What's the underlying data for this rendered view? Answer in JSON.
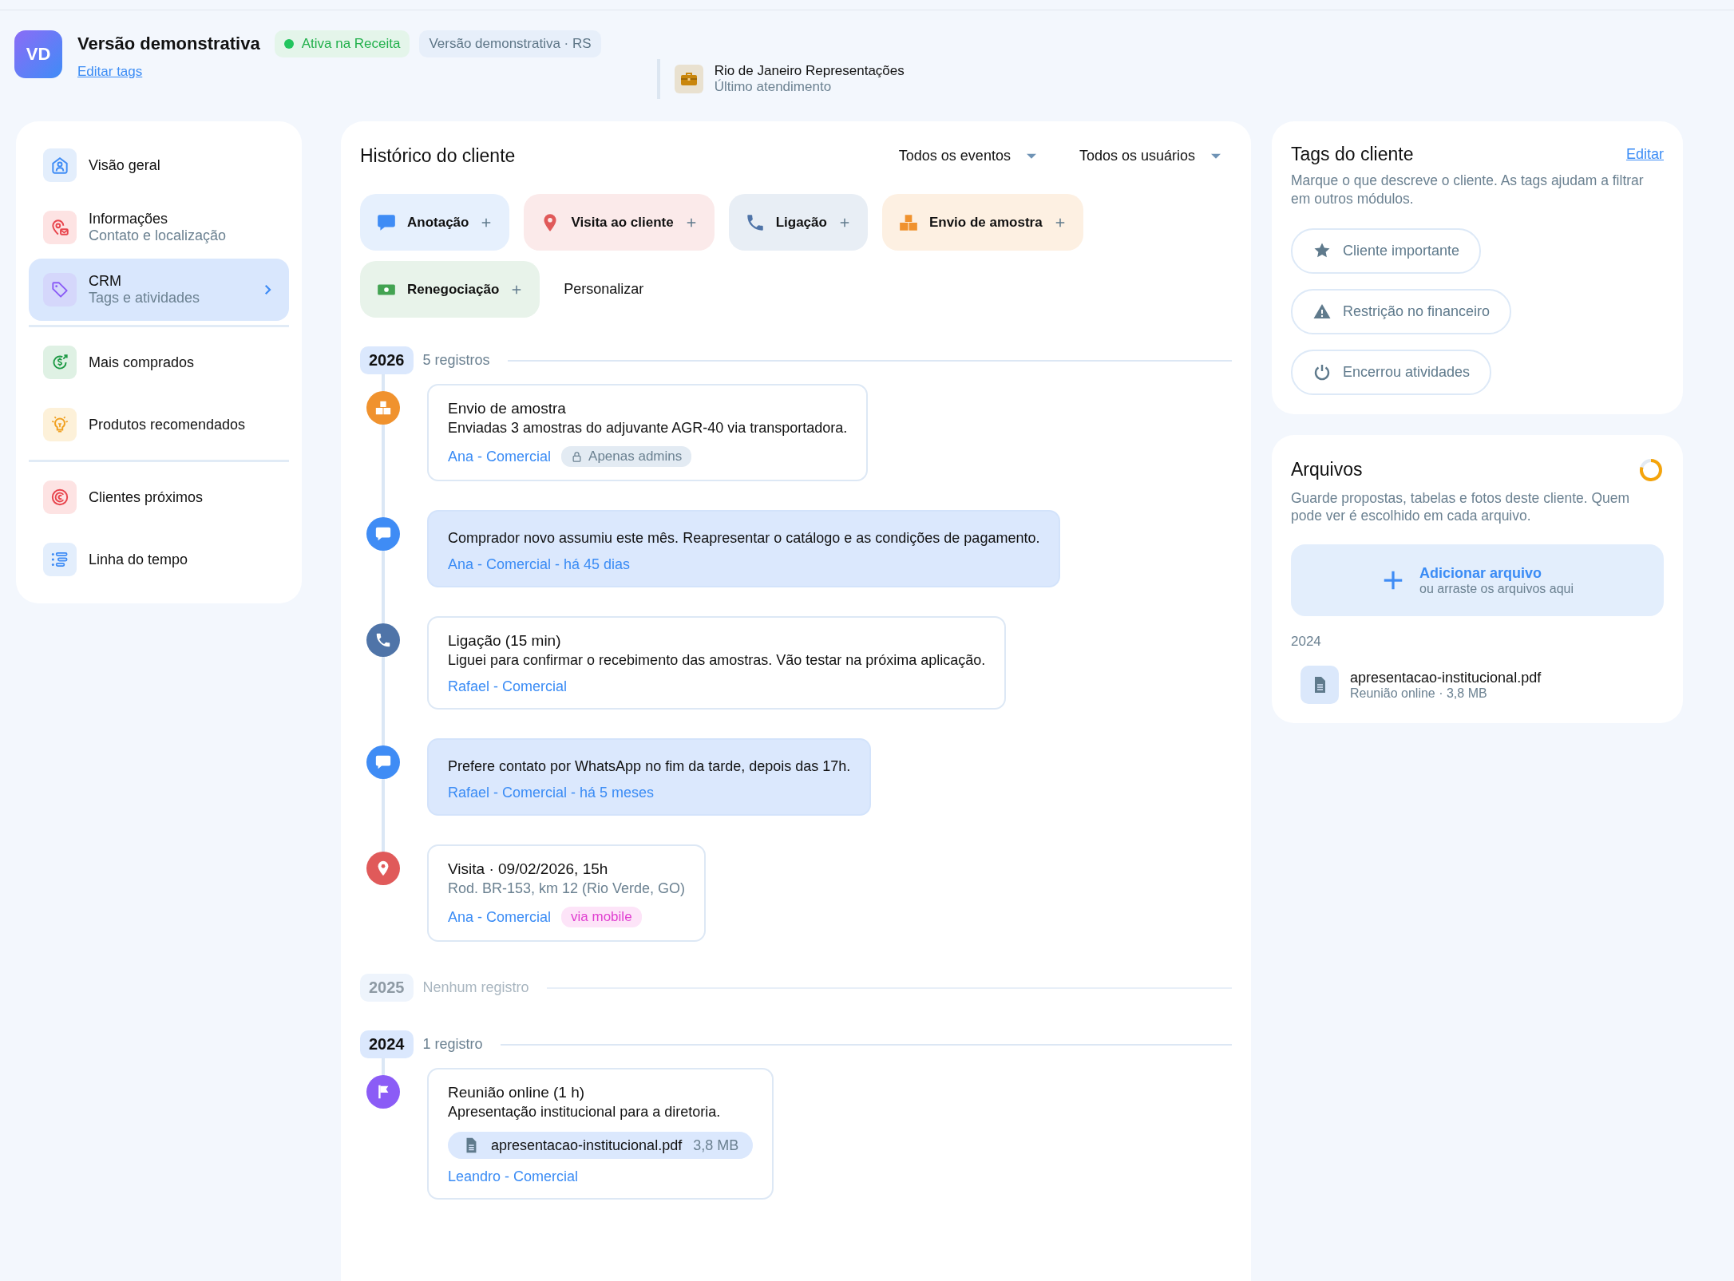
{
  "header": {
    "avatar": "VD",
    "title": "Versão demonstrativa",
    "edit_tags_link": "Editar tags",
    "badges": [
      {
        "kind": "status",
        "label": "Ativa na Receita"
      },
      {
        "kind": "plain",
        "label": "Versão demonstrativa · RS"
      }
    ],
    "last_contact": {
      "name": "Rio de Janeiro Representações",
      "caption": "Último atendimento"
    }
  },
  "sidebar": {
    "groups": [
      [
        {
          "kind": "overview",
          "label": "Visão geral",
          "selected": false
        },
        {
          "kind": "info",
          "label": "Informações",
          "sublabel": "Contato e localização",
          "selected": false
        },
        {
          "kind": "crm",
          "label": "CRM",
          "sublabel": "Tags e atividades",
          "selected": true
        }
      ],
      [
        {
          "kind": "purchases",
          "label": "Mais comprados",
          "selected": false
        },
        {
          "kind": "recommended",
          "label": "Produtos recomendados",
          "selected": false
        }
      ],
      [
        {
          "kind": "nearby",
          "label": "Clientes próximos",
          "selected": false
        },
        {
          "kind": "timeline",
          "label": "Linha do tempo",
          "selected": false
        }
      ]
    ]
  },
  "history": {
    "title": "Histórico do cliente",
    "filters": [
      "Todos os eventos",
      "Todos os usuários"
    ],
    "quick_actions": [
      {
        "kind": "note",
        "label": "Anotação"
      },
      {
        "kind": "visit",
        "label": "Visita ao cliente"
      },
      {
        "kind": "call",
        "label": "Ligação"
      },
      {
        "kind": "sample",
        "label": "Envio de amostra"
      },
      {
        "kind": "renegotiation",
        "label": "Renegociação"
      }
    ],
    "customize": "Personalizar",
    "years": [
      {
        "year": "2026",
        "count": "5 registros",
        "empty": false,
        "events": [
          {
            "kind": "sample",
            "title": "Envio de amostra",
            "text": "Enviadas 3 amostras do adjuvante AGR-40 via transportadora.",
            "author": "Ana - Comercial",
            "badge": {
              "kind": "lock",
              "label": "Apenas admins"
            }
          },
          {
            "kind": "note",
            "text": "Comprador novo assumiu este mês. Reapresentar o catálogo e as condições de pagamento.",
            "author": "Ana - Comercial - há 45 dias"
          },
          {
            "kind": "call",
            "title": "Ligação (15 min)",
            "text": "Liguei para confirmar o recebimento das amostras. Vão testar na próxima aplicação.",
            "author": "Rafael - Comercial"
          },
          {
            "kind": "note",
            "text": "Prefere contato por WhatsApp no fim da tarde, depois das 17h.",
            "author": "Rafael - Comercial - há 5 meses"
          },
          {
            "kind": "visit",
            "title": "Visita · 09/02/2026, 15h",
            "address": "Rod. BR-153, km 12 (Rio Verde, GO)",
            "author": "Ana - Comercial",
            "badge": {
              "kind": "mobile",
              "label": "via mobile"
            }
          }
        ]
      },
      {
        "year": "2025",
        "count": "Nenhum registro",
        "empty": true
      },
      {
        "year": "2024",
        "count": "1 registro",
        "empty": false,
        "events": [
          {
            "kind": "meeting",
            "title": "Reunião online (1 h)",
            "text": "Apresentação institucional para a diretoria.",
            "attachment": {
              "name": "apresentacao-institucional.pdf",
              "size": "3,8 MB"
            },
            "author": "Leandro - Comercial"
          }
        ]
      }
    ]
  },
  "tags_card": {
    "title": "Tags do cliente",
    "edit_link": "Editar",
    "description": "Marque o que descreve o cliente. As tags ajudam a filtrar em outros módulos.",
    "tags": [
      {
        "kind": "star",
        "label": "Cliente importante"
      },
      {
        "kind": "warning",
        "label": "Restrição no financeiro"
      },
      {
        "kind": "power",
        "label": "Encerrou atividades"
      }
    ]
  },
  "files_card": {
    "title": "Arquivos",
    "description": "Guarde propostas, tabelas e fotos deste cliente. Quem pode ver é escolhido em cada arquivo.",
    "upload": {
      "label": "Adicionar arquivo",
      "hint": "ou arraste os arquivos aqui"
    },
    "groups": [
      {
        "year": "2024",
        "files": [
          {
            "name": "apresentacao-institucional.pdf",
            "meta": "Reunião online · 3,8 MB"
          }
        ]
      }
    ]
  }
}
